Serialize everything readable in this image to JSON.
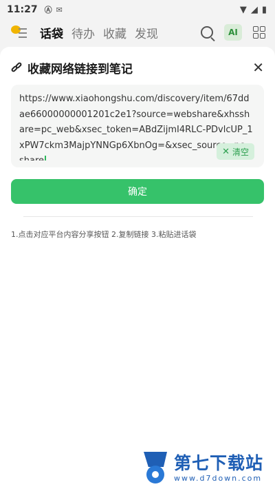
{
  "status_bar": {
    "time": "11:27",
    "icons": [
      "notification-a-icon",
      "mail-icon",
      "wifi-icon",
      "signal-icon",
      "battery-icon"
    ]
  },
  "nav": {
    "tabs": [
      {
        "label": "话袋",
        "active": true
      },
      {
        "label": "待办",
        "active": false
      },
      {
        "label": "收藏",
        "active": false
      },
      {
        "label": "发现",
        "active": false
      }
    ],
    "ai_label": "AI"
  },
  "sheet": {
    "title": "收藏网络链接到笔记",
    "url_value": "https://www.xiaohongshu.com/discovery/item/67ddae66000000001201c2e1?source=webshare&xhsshare=pc_web&xsec_token=ABdZijmI4RLC-PDvlcUP_1xPW7ckm3MajpYNNGp6XbnOg=&xsec_source=pc_share",
    "clear_label": "清空",
    "confirm_label": "确定",
    "hint": "1.点击对应平台内容分享按钮 2.复制链接 3.粘贴进话袋"
  },
  "watermark": {
    "name": "第七下载站",
    "url": "www.d7down.com"
  },
  "colors": {
    "accent": "#36c26a",
    "accent_light": "#d5f0dc",
    "watermark_blue": "#1f5fb5"
  }
}
